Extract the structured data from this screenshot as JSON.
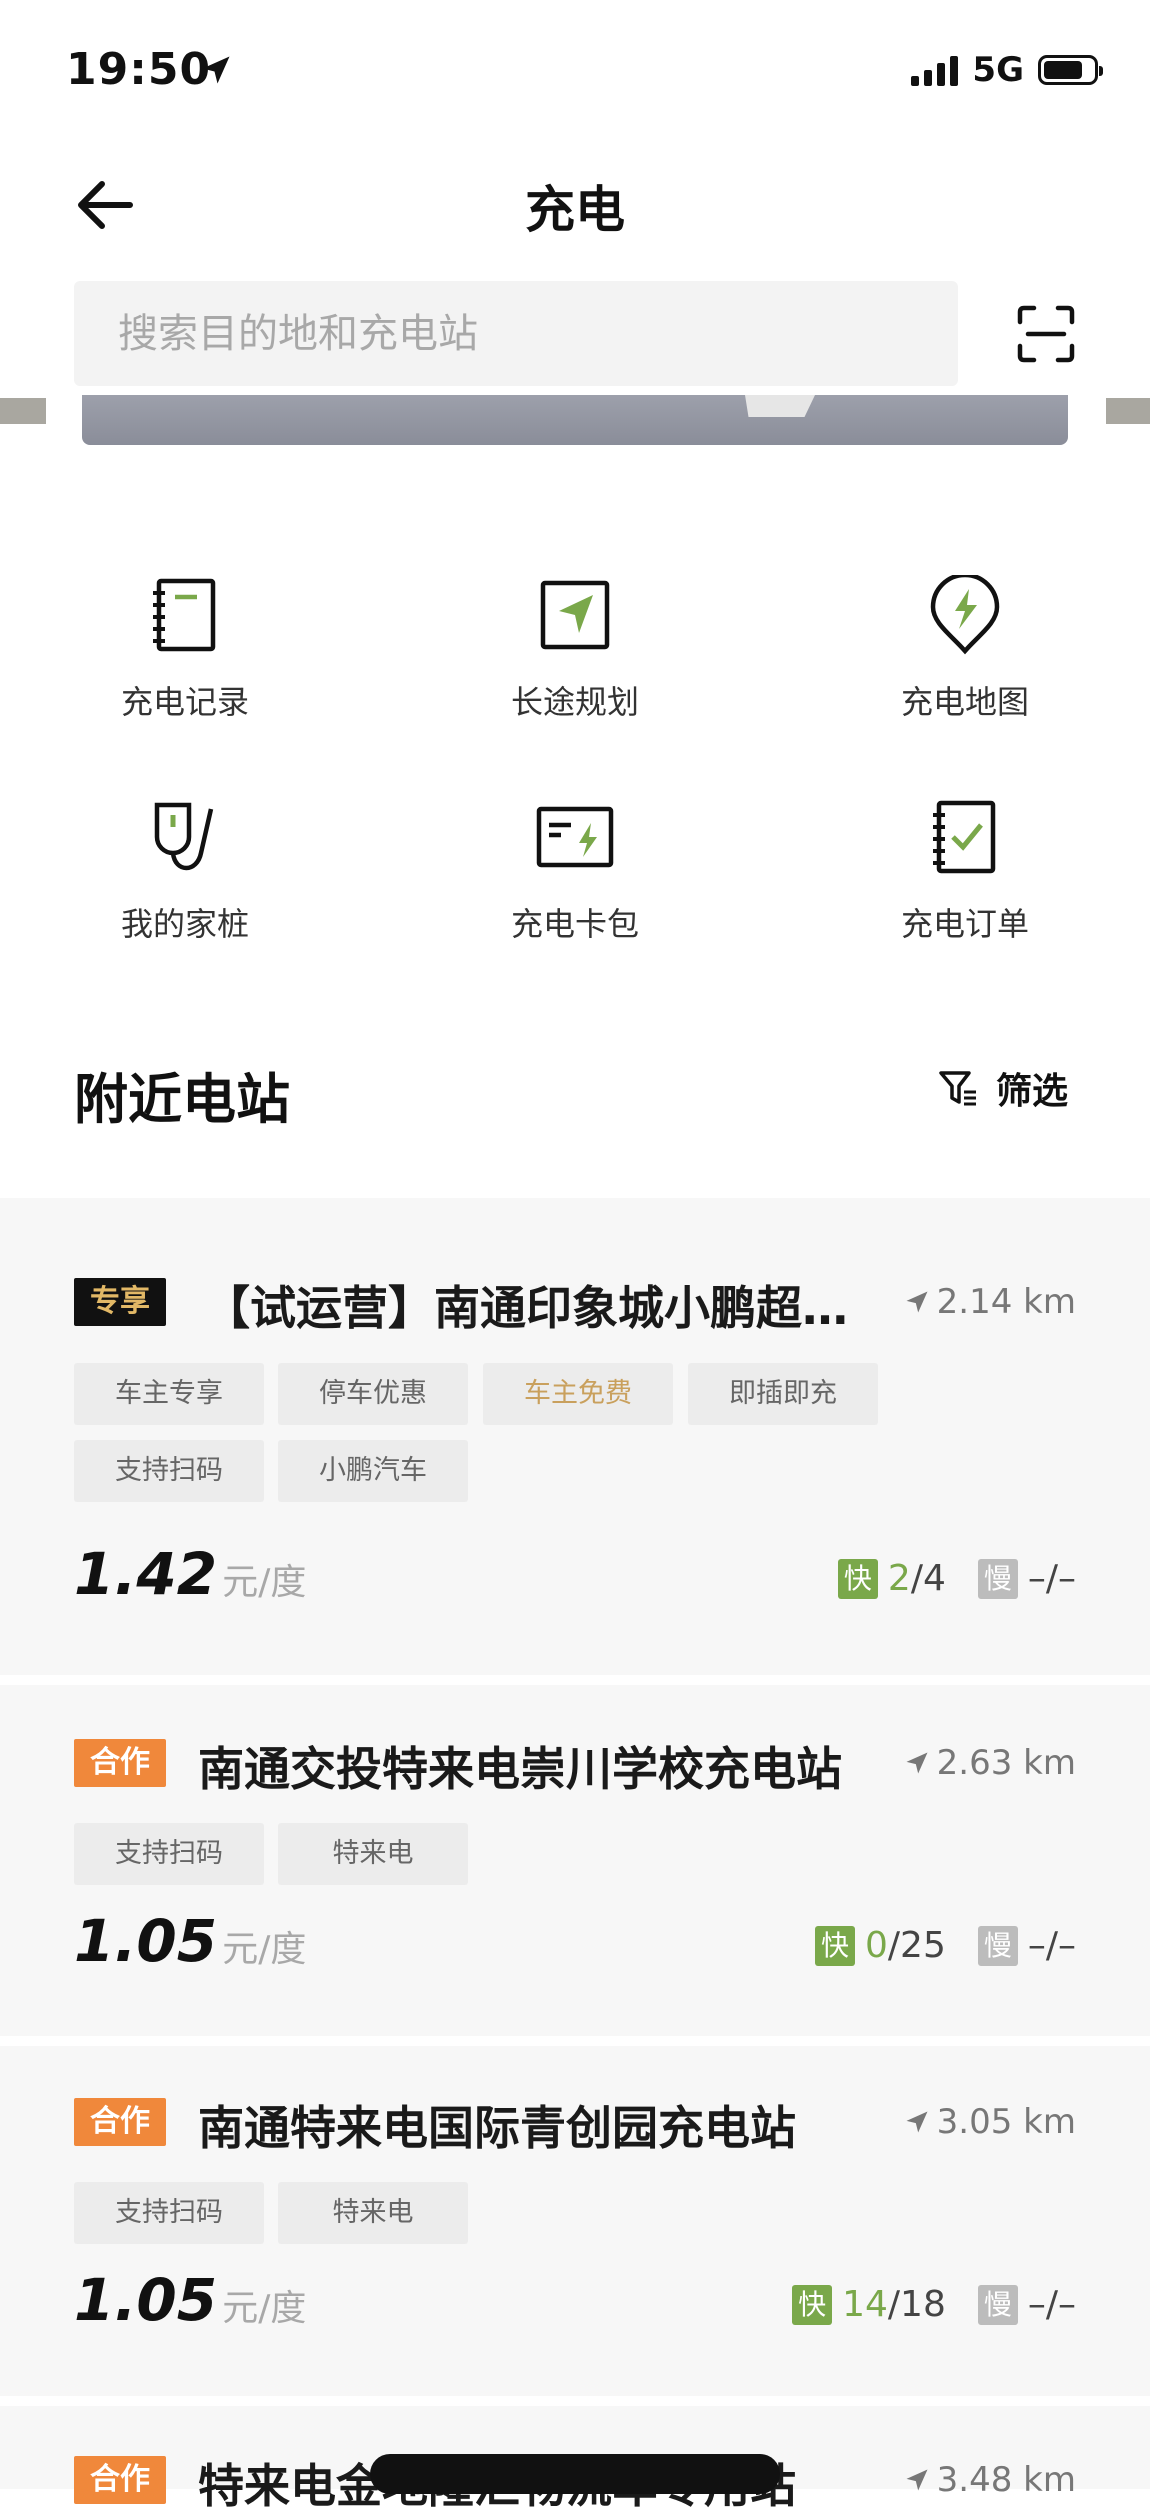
{
  "status_bar": {
    "time": "19:50",
    "network": "5G",
    "battery_level": 0.8
  },
  "header": {
    "title": "充电"
  },
  "search": {
    "placeholder": "搜索目的地和充电站"
  },
  "quick_actions": [
    {
      "label": "充电记录",
      "icon": "notebook-icon"
    },
    {
      "label": "长途规划",
      "icon": "route-plan-icon"
    },
    {
      "label": "充电地图",
      "icon": "map-pin-bolt-icon"
    },
    {
      "label": "我的家桩",
      "icon": "home-charger-icon"
    },
    {
      "label": "充电卡包",
      "icon": "card-wallet-icon"
    },
    {
      "label": "充电订单",
      "icon": "order-check-icon"
    }
  ],
  "nearby": {
    "title": "附近电站",
    "filter_label": "筛选"
  },
  "stations": [
    {
      "badge": "专享",
      "name": "【试运营】南通印象城小鹏超…",
      "distance": "2.14 km",
      "tags": [
        "车主专享",
        "停车优惠",
        "车主免费",
        "即插即充",
        "支持扫码",
        "小鹏汽车"
      ],
      "price": "1.42",
      "unit": "元/度",
      "fast_label": "快",
      "fast_avail": "2",
      "fast_total": "/4",
      "slow_label": "慢",
      "slow_value": "–/–"
    },
    {
      "badge": "合作",
      "name": "南通交投特来电崇川学校充电站",
      "distance": "2.63 km",
      "tags": [
        "支持扫码",
        "特来电"
      ],
      "price": "1.05",
      "unit": "元/度",
      "fast_label": "快",
      "fast_avail": "0",
      "fast_total": "/25",
      "slow_label": "慢",
      "slow_value": "–/–"
    },
    {
      "badge": "合作",
      "name": "南通特来电国际青创园充电站",
      "distance": "3.05 km",
      "tags": [
        "支持扫码",
        "特来电"
      ],
      "price": "1.05",
      "unit": "元/度",
      "fast_label": "快",
      "fast_avail": "14",
      "fast_total": "/18",
      "slow_label": "慢",
      "slow_value": "–/–"
    },
    {
      "badge": "合作",
      "name": "特来电金地隆汇物流车专用站",
      "distance": "3.48 km"
    }
  ],
  "colors": {
    "accent_green": "#7aa84a",
    "coop_orange": "#f0883b",
    "exclusive_gold": "#e2b866"
  }
}
